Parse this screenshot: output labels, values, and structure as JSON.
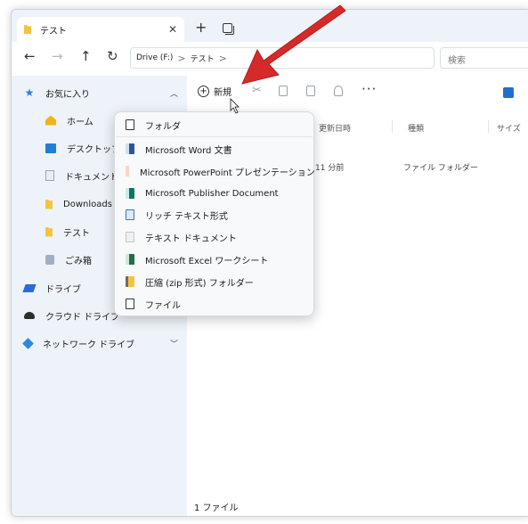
{
  "tab": {
    "title": "テスト",
    "close_glyph": "✕",
    "new_tab_glyph": "+"
  },
  "address": {
    "drive": "Drive (F:)",
    "folder": "テスト",
    "separator": ">"
  },
  "search": {
    "placeholder": "検索"
  },
  "sidebar": {
    "items": [
      {
        "label": "お気に入り",
        "icon": "star-icon"
      },
      {
        "label": "ホーム",
        "icon": "home-icon"
      },
      {
        "label": "デスクトップ",
        "icon": "desktop-icon"
      },
      {
        "label": "ドキュメント",
        "icon": "document-icon"
      },
      {
        "label": "Downloads",
        "icon": "folder-icon"
      },
      {
        "label": "テスト",
        "icon": "folder-icon"
      },
      {
        "label": "ごみ箱",
        "icon": "recycle-bin-icon"
      },
      {
        "label": "ドライブ",
        "icon": "drive-icon"
      },
      {
        "label": "クラウド ドライブ",
        "icon": "cloud-drive-icon"
      },
      {
        "label": "ネットワーク ドライブ",
        "icon": "network-drive-icon"
      }
    ]
  },
  "toolbar": {
    "new_label": "新規",
    "more_glyph": "···"
  },
  "columns": {
    "modified": "更新日時",
    "type": "種類",
    "size": "サイズ"
  },
  "row": {
    "modified": "11 分前",
    "type": "ファイル フォルダー"
  },
  "menu": {
    "items": [
      {
        "label": "フォルダ",
        "icon": "folder-outline-icon"
      },
      {
        "label": "Microsoft Word 文書",
        "icon": "word-icon"
      },
      {
        "label": "Microsoft PowerPoint プレゼンテーション",
        "icon": "powerpoint-icon"
      },
      {
        "label": "Microsoft Publisher Document",
        "icon": "publisher-icon"
      },
      {
        "label": "リッチ テキスト形式",
        "icon": "rich-text-icon"
      },
      {
        "label": "テキスト ドキュメント",
        "icon": "text-document-icon"
      },
      {
        "label": "Microsoft Excel ワークシート",
        "icon": "excel-icon"
      },
      {
        "label": "圧縮 (zip 形式) フォルダー",
        "icon": "zip-folder-icon"
      },
      {
        "label": "ファイル",
        "icon": "file-icon"
      }
    ]
  },
  "status": {
    "count": "1 ファイル"
  },
  "colors": {
    "accent": "#1e6fd0",
    "arrow": "#d42a2a"
  }
}
